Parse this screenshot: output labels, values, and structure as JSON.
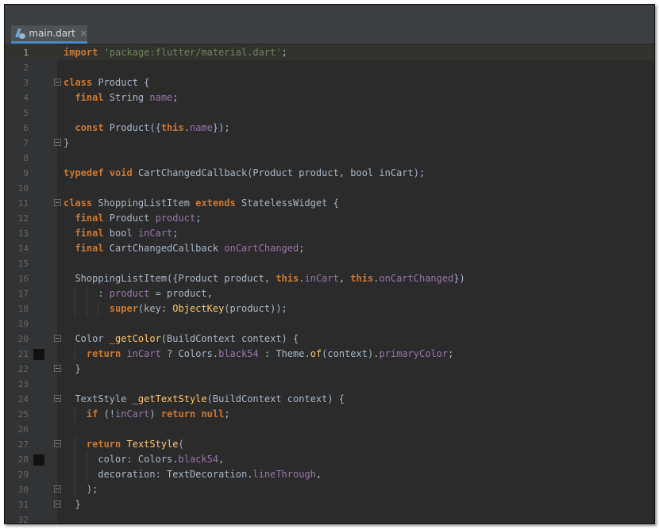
{
  "tab": {
    "label": "main.dart",
    "close": "✕",
    "icon": "dart-file-icon"
  },
  "current_line": 1,
  "colors": {
    "keyword": "#cc7832",
    "string": "#6a8759",
    "field": "#9876aa",
    "function": "#ffc66d",
    "text": "#a9b7c6"
  },
  "lines": [
    {
      "n": "1",
      "tokens": [
        [
          "import",
          "kw"
        ],
        [
          " ",
          ""
        ],
        [
          "'package:flutter/material.dart'",
          "str"
        ],
        [
          ";",
          ""
        ]
      ]
    },
    {
      "n": "2",
      "tokens": []
    },
    {
      "n": "3",
      "fold": true,
      "tokens": [
        [
          "class",
          "kw"
        ],
        [
          " Product {",
          ""
        ]
      ]
    },
    {
      "n": "4",
      "tokens": [
        [
          "  ",
          ""
        ],
        [
          "final",
          "kw"
        ],
        [
          " String ",
          ""
        ],
        [
          "name",
          "fld"
        ],
        [
          ";",
          ""
        ]
      ]
    },
    {
      "n": "5",
      "tokens": []
    },
    {
      "n": "6",
      "tokens": [
        [
          "  ",
          ""
        ],
        [
          "const",
          "kw"
        ],
        [
          " Product({",
          ""
        ],
        [
          "this",
          "kw"
        ],
        [
          ".",
          ""
        ],
        [
          "name",
          "fld"
        ],
        [
          "});",
          ""
        ]
      ]
    },
    {
      "n": "7",
      "fold": true,
      "tokens": [
        [
          "}",
          ""
        ]
      ]
    },
    {
      "n": "8",
      "tokens": []
    },
    {
      "n": "9",
      "tokens": [
        [
          "typedef",
          "kw"
        ],
        [
          " ",
          ""
        ],
        [
          "void",
          "kw"
        ],
        [
          " CartChangedCallback(Product product, bool inCart);",
          ""
        ]
      ]
    },
    {
      "n": "10",
      "tokens": []
    },
    {
      "n": "11",
      "fold": true,
      "tokens": [
        [
          "class",
          "kw"
        ],
        [
          " ShoppingListItem ",
          ""
        ],
        [
          "extends",
          "kw"
        ],
        [
          " StatelessWidget {",
          ""
        ]
      ]
    },
    {
      "n": "12",
      "tokens": [
        [
          "  ",
          ""
        ],
        [
          "final",
          "kw"
        ],
        [
          " Product ",
          ""
        ],
        [
          "product",
          "fld"
        ],
        [
          ";",
          ""
        ]
      ]
    },
    {
      "n": "13",
      "tokens": [
        [
          "  ",
          ""
        ],
        [
          "final",
          "kw"
        ],
        [
          " bool ",
          ""
        ],
        [
          "inCart",
          "fld"
        ],
        [
          ";",
          ""
        ]
      ]
    },
    {
      "n": "14",
      "tokens": [
        [
          "  ",
          ""
        ],
        [
          "final",
          "kw"
        ],
        [
          " CartChangedCallback ",
          ""
        ],
        [
          "onCartChanged",
          "fld"
        ],
        [
          ";",
          ""
        ]
      ]
    },
    {
      "n": "15",
      "tokens": []
    },
    {
      "n": "16",
      "tokens": [
        [
          "  ShoppingListItem({Product product, ",
          ""
        ],
        [
          "this",
          "kw"
        ],
        [
          ".",
          ""
        ],
        [
          "inCart",
          "fld"
        ],
        [
          ", ",
          ""
        ],
        [
          "this",
          "kw"
        ],
        [
          ".",
          ""
        ],
        [
          "onCartChanged",
          "fld"
        ],
        [
          "})",
          ""
        ]
      ]
    },
    {
      "n": "17",
      "tokens": [
        [
          "      : ",
          ""
        ],
        [
          "product",
          "fld"
        ],
        [
          " = product,",
          ""
        ]
      ]
    },
    {
      "n": "18",
      "tokens": [
        [
          "        ",
          ""
        ],
        [
          "super",
          "kw"
        ],
        [
          "(key: ",
          ""
        ],
        [
          "ObjectKey",
          "fn"
        ],
        [
          "(product));",
          ""
        ]
      ]
    },
    {
      "n": "19",
      "tokens": []
    },
    {
      "n": "20",
      "fold": true,
      "tokens": [
        [
          "  Color ",
          ""
        ],
        [
          "_getColor",
          "fn"
        ],
        [
          "(BuildContext context) {",
          ""
        ]
      ]
    },
    {
      "n": "21",
      "mark": true,
      "tokens": [
        [
          "    ",
          ""
        ],
        [
          "return",
          "kw"
        ],
        [
          " ",
          ""
        ],
        [
          "inCart",
          "fld"
        ],
        [
          " ? Colors.",
          ""
        ],
        [
          "black54",
          "fld"
        ],
        [
          " : Theme.",
          ""
        ],
        [
          "of",
          "fn"
        ],
        [
          "(context).",
          ""
        ],
        [
          "primaryColor",
          "fld"
        ],
        [
          ";",
          ""
        ]
      ]
    },
    {
      "n": "22",
      "fold": true,
      "tokens": [
        [
          "  }",
          ""
        ]
      ]
    },
    {
      "n": "23",
      "tokens": []
    },
    {
      "n": "24",
      "fold": true,
      "tokens": [
        [
          "  TextStyle ",
          ""
        ],
        [
          "_getTextStyle",
          "fn"
        ],
        [
          "(BuildContext context) {",
          ""
        ]
      ]
    },
    {
      "n": "25",
      "tokens": [
        [
          "    ",
          ""
        ],
        [
          "if",
          "kw"
        ],
        [
          " (!",
          ""
        ],
        [
          "inCart",
          "fld"
        ],
        [
          ") ",
          ""
        ],
        [
          "return",
          "kw"
        ],
        [
          " ",
          ""
        ],
        [
          "null",
          "kw"
        ],
        [
          ";",
          ""
        ]
      ]
    },
    {
      "n": "26",
      "tokens": []
    },
    {
      "n": "27",
      "fold": true,
      "tokens": [
        [
          "    ",
          ""
        ],
        [
          "return",
          "kw"
        ],
        [
          " ",
          ""
        ],
        [
          "TextStyle",
          "fn"
        ],
        [
          "(",
          ""
        ]
      ]
    },
    {
      "n": "28",
      "mark": true,
      "tokens": [
        [
          "      color: Colors.",
          ""
        ],
        [
          "black54",
          "fld"
        ],
        [
          ",",
          ""
        ]
      ]
    },
    {
      "n": "29",
      "tokens": [
        [
          "      decoration: TextDecoration.",
          ""
        ],
        [
          "lineThrough",
          "fld"
        ],
        [
          ",",
          ""
        ]
      ]
    },
    {
      "n": "30",
      "fold": true,
      "tokens": [
        [
          "    );",
          ""
        ]
      ]
    },
    {
      "n": "31",
      "fold": true,
      "tokens": [
        [
          "  }",
          ""
        ]
      ]
    },
    {
      "n": "32",
      "tokens": []
    }
  ]
}
